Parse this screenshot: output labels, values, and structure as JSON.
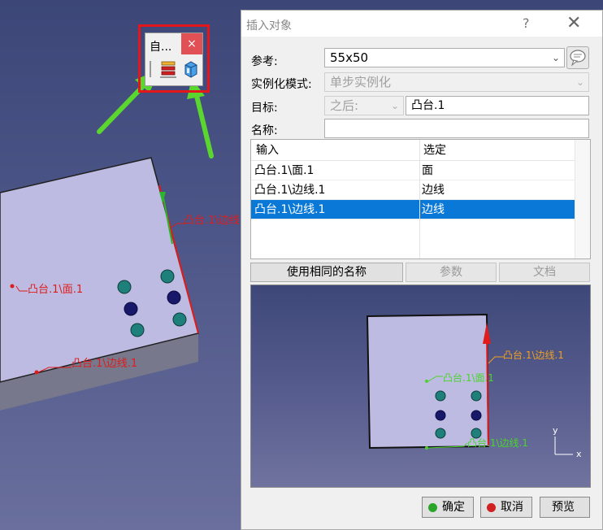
{
  "mini_toolbar": {
    "title": "自...",
    "close": "×",
    "button1_icon": "instantiate-icon",
    "button2_icon": "catalog-icon"
  },
  "scene": {
    "labels": {
      "face": "凸台.1\\面.1",
      "edge_bottom": "凸台.1\\边线.1",
      "edge_right": "凸台.1\\边线"
    }
  },
  "dialog": {
    "title": "插入对象",
    "help": "?",
    "close": "✕",
    "reference_label": "参考:",
    "reference_value": "55x50",
    "instantiation_label": "实例化模式:",
    "instantiation_value": "单步实例化",
    "target_label": "目标:",
    "target_position": "之后:",
    "target_value": "凸台.1",
    "name_label": "名称:",
    "name_value": "",
    "table": {
      "headers": [
        "输入",
        "选定"
      ],
      "rows": [
        {
          "input": "凸台.1\\面.1",
          "selected": "面"
        },
        {
          "input": "凸台.1\\边线.1",
          "selected": "边线"
        },
        {
          "input": "凸台.1\\边线.1",
          "selected": "边线"
        }
      ]
    },
    "buttons": {
      "same_name": "使用相同的名称",
      "params": "参数",
      "docs": "文档"
    },
    "preview_labels": {
      "edge_right": "凸台.1\\边线.1",
      "face": "凸台.1\\面.1",
      "edge_bottom": "凸台.1\\边线.1",
      "axis_y": "y",
      "axis_x": "x"
    },
    "footer": {
      "ok": "确定",
      "cancel": "取消",
      "preview": "预览"
    }
  },
  "colors": {
    "selection": "#0a78d7",
    "annotation_red": "#e01b1b",
    "annotation_green": "#4ad42b",
    "label_orange": "#f0a020",
    "hole_teal": "#1f7f7a",
    "hole_navy": "#18186a"
  }
}
